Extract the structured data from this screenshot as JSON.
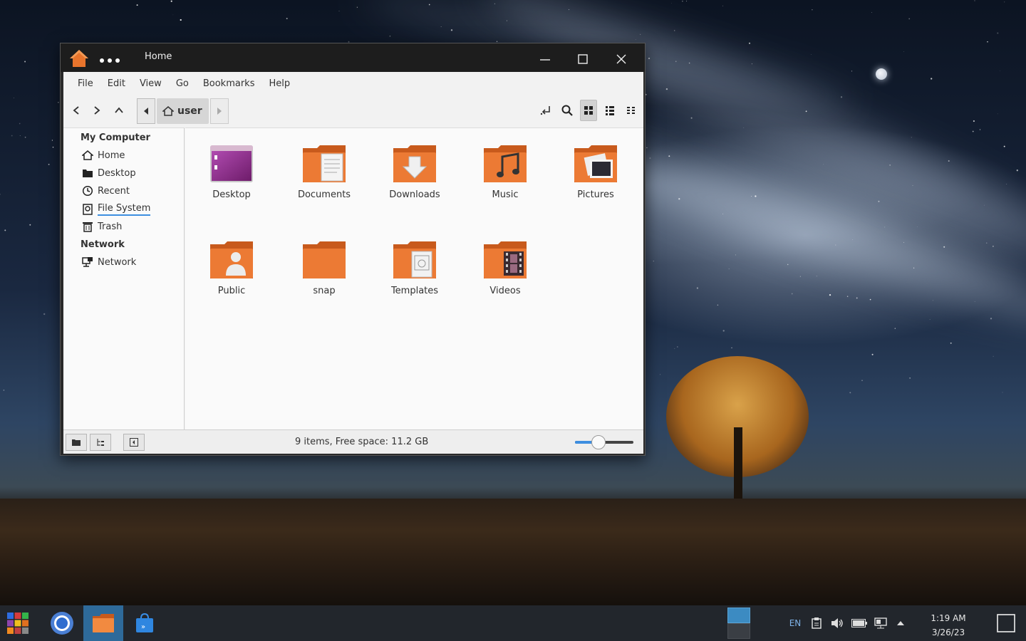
{
  "window": {
    "title": "Home",
    "menu": [
      "File",
      "Edit",
      "View",
      "Go",
      "Bookmarks",
      "Help"
    ],
    "path": {
      "current": "user"
    },
    "sidebar": {
      "sections": [
        {
          "heading": "My Computer",
          "items": [
            {
              "label": "Home",
              "icon": "home-icon"
            },
            {
              "label": "Desktop",
              "icon": "folder-icon"
            },
            {
              "label": "Recent",
              "icon": "clock-icon"
            },
            {
              "label": "File System",
              "icon": "drive-icon"
            },
            {
              "label": "Trash",
              "icon": "trash-icon"
            }
          ]
        },
        {
          "heading": "Network",
          "items": [
            {
              "label": "Network",
              "icon": "network-icon"
            }
          ]
        }
      ]
    },
    "files": [
      {
        "label": "Desktop",
        "icon": "desktop-folder-icon"
      },
      {
        "label": "Documents",
        "icon": "documents-folder-icon"
      },
      {
        "label": "Downloads",
        "icon": "downloads-folder-icon"
      },
      {
        "label": "Music",
        "icon": "music-folder-icon"
      },
      {
        "label": "Pictures",
        "icon": "pictures-folder-icon"
      },
      {
        "label": "Public",
        "icon": "public-folder-icon"
      },
      {
        "label": "snap",
        "icon": "folder-icon"
      },
      {
        "label": "Templates",
        "icon": "templates-folder-icon"
      },
      {
        "label": "Videos",
        "icon": "videos-folder-icon"
      }
    ],
    "status": "9 items, Free space: 11.2 GB",
    "zoom_level": 0.4
  },
  "taskbar": {
    "language": "EN",
    "time": "1:19 AM",
    "date": "3/26/23"
  },
  "colors": {
    "accent": "#3d8ee0",
    "folder_orange": "#e8742c",
    "taskbar_active": "#2e6a9a"
  }
}
